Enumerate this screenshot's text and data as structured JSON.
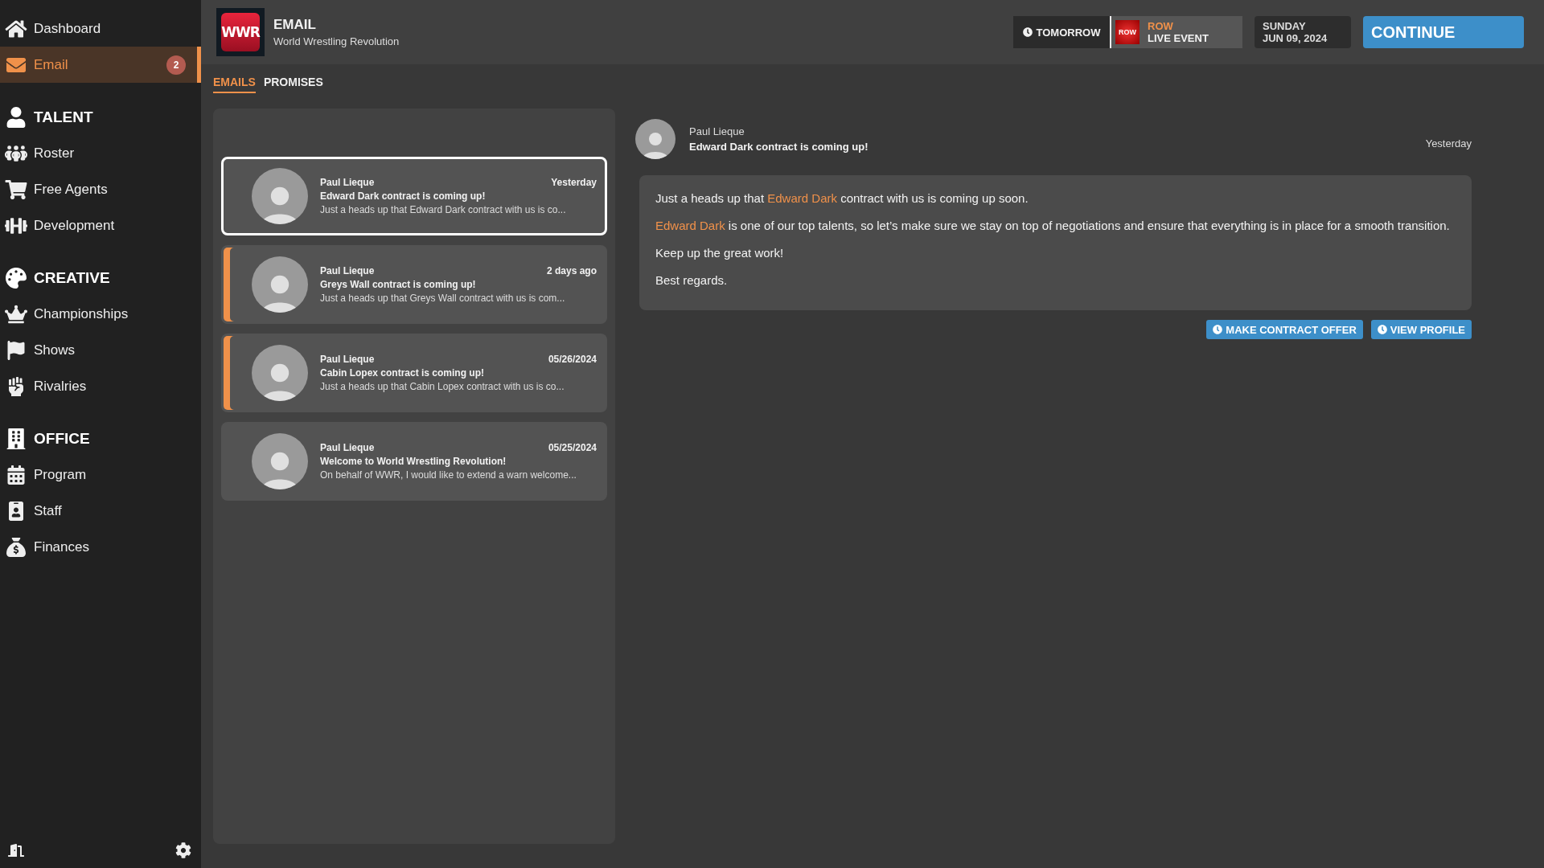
{
  "sidebar": {
    "top": [
      {
        "label": "Dashboard",
        "selected": false
      },
      {
        "label": "Email",
        "selected": true,
        "badge": "2"
      }
    ],
    "sections": [
      {
        "title": "TALENT",
        "items": [
          {
            "label": "Roster",
            "selected": false
          },
          {
            "label": "Free Agents",
            "selected": false
          },
          {
            "label": "Development",
            "selected": false
          }
        ]
      },
      {
        "title": "CREATIVE",
        "items": [
          {
            "label": "Championships",
            "selected": false
          },
          {
            "label": "Shows",
            "selected": false
          },
          {
            "label": "Rivalries",
            "selected": false
          }
        ]
      },
      {
        "title": "OFFICE",
        "items": [
          {
            "label": "Program",
            "selected": false
          },
          {
            "label": "Staff",
            "selected": false
          },
          {
            "label": "Finances",
            "selected": false
          }
        ]
      }
    ]
  },
  "header": {
    "logo_text": "WWR",
    "title": "EMAIL",
    "subtitle": "World Wrestling Revolution",
    "when": "TOMORROW",
    "event": {
      "logo_text": "ROW",
      "name": "ROW",
      "type": "LIVE EVENT"
    },
    "date": {
      "day": "SUNDAY",
      "date": "JUN 09, 2024"
    },
    "continue": "CONTINUE"
  },
  "tabs": [
    {
      "label": "EMAILS",
      "selected": true
    },
    {
      "label": "PROMISES",
      "selected": false
    }
  ],
  "emails": [
    {
      "sender": "Paul Lieque",
      "date": "Yesterday",
      "subject": "Edward Dark contract is coming up!",
      "preview": "Just a heads up that Edward Dark contract with us is co...",
      "selected": true,
      "unread": false
    },
    {
      "sender": "Paul Lieque",
      "date": "2 days ago",
      "subject": "Greys Wall contract is coming up!",
      "preview": "Just a heads up that Greys Wall contract with us is com...",
      "selected": false,
      "unread": true
    },
    {
      "sender": "Paul Lieque",
      "date": "05/26/2024",
      "subject": "Cabin Lopex contract is coming up!",
      "preview": "Just a heads up that Cabin Lopex contract with us is co...",
      "selected": false,
      "unread": true
    },
    {
      "sender": "Paul Lieque",
      "date": "05/25/2024",
      "subject": "Welcome to World Wrestling Revolution!",
      "preview": "On behalf of WWR, I would like to extend a warn welcome...",
      "selected": false,
      "unread": false
    }
  ],
  "detail": {
    "sender": "Paul Lieque",
    "subject": "Edward Dark contract is coming up!",
    "date": "Yesterday",
    "paragraphs": [
      [
        {
          "text": "Just a heads up that ",
          "link": false
        },
        {
          "text": "Edward Dark",
          "link": true
        },
        {
          "text": " contract with us is coming up soon.",
          "link": false
        }
      ],
      [
        {
          "text": "Edward Dark",
          "link": true
        },
        {
          "text": " is one of our top talents, so let’s make sure we stay on top of negotiations and ensure that everything is in place for a smooth transition.",
          "link": false
        }
      ],
      [
        {
          "text": "Keep up the great work!",
          "link": false
        }
      ],
      [
        {
          "text": "Best regards.",
          "link": false
        }
      ]
    ],
    "actions": [
      "MAKE CONTRACT OFFER",
      "VIEW PROFILE"
    ]
  }
}
